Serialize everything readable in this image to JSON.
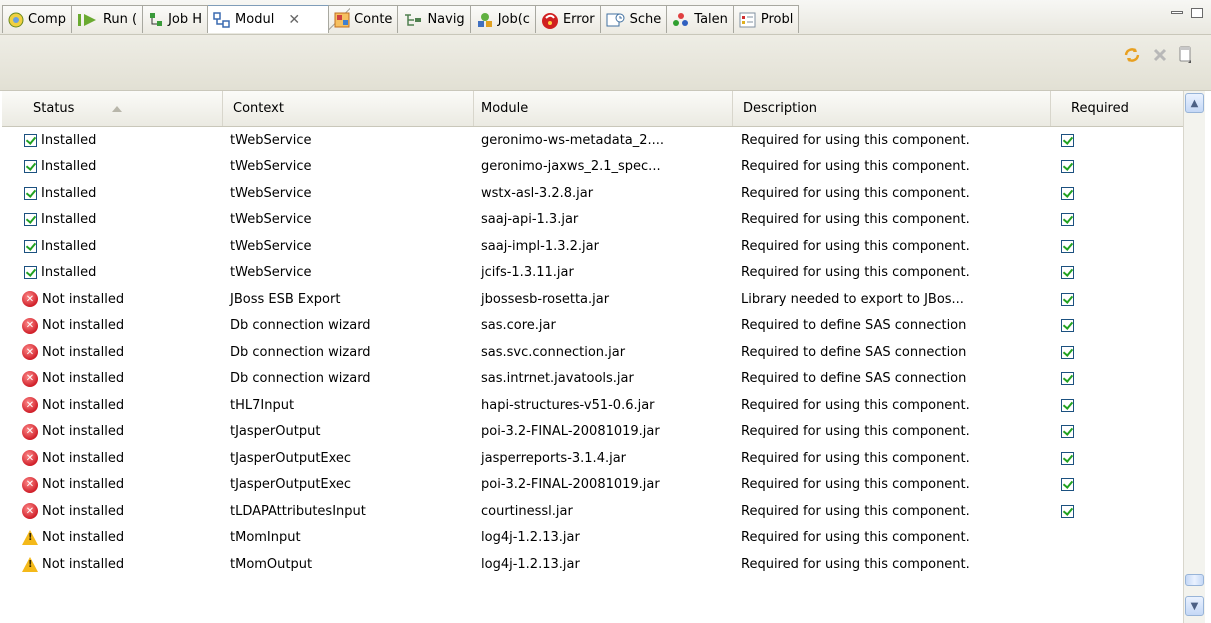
{
  "tabs": [
    {
      "label": "Comp",
      "icon": "component-icon"
    },
    {
      "label": "Run (",
      "icon": "run-icon"
    },
    {
      "label": "Job H",
      "icon": "job-hierarchy-icon"
    },
    {
      "label": "Modul",
      "icon": "modules-icon",
      "active": true
    },
    {
      "label": "Conte",
      "icon": "contexts-icon"
    },
    {
      "label": "Navig",
      "icon": "navigator-icon"
    },
    {
      "label": "Job(c",
      "icon": "job-icon"
    },
    {
      "label": "Error",
      "icon": "error-log-icon"
    },
    {
      "label": "Sche",
      "icon": "scheduler-icon"
    },
    {
      "label": "Talen",
      "icon": "talend-icon"
    },
    {
      "label": "Probl",
      "icon": "problems-icon"
    }
  ],
  "columns": [
    "Status",
    "Context",
    "Module",
    "Description",
    "Required"
  ],
  "rows": [
    {
      "status": "Installed",
      "state": "installed",
      "context": "tWebService",
      "module": "geronimo-ws-metadata_2....",
      "description": "Required for using this component.",
      "required": true
    },
    {
      "status": "Installed",
      "state": "installed",
      "context": "tWebService",
      "module": "geronimo-jaxws_2.1_spec...",
      "description": "Required for using this component.",
      "required": true
    },
    {
      "status": "Installed",
      "state": "installed",
      "context": "tWebService",
      "module": "wstx-asl-3.2.8.jar",
      "description": "Required for using this component.",
      "required": true
    },
    {
      "status": "Installed",
      "state": "installed",
      "context": "tWebService",
      "module": "saaj-api-1.3.jar",
      "description": "Required for using this component.",
      "required": true
    },
    {
      "status": "Installed",
      "state": "installed",
      "context": "tWebService",
      "module": "saaj-impl-1.3.2.jar",
      "description": "Required for using this component.",
      "required": true
    },
    {
      "status": "Installed",
      "state": "installed",
      "context": "tWebService",
      "module": "jcifs-1.3.11.jar",
      "description": "Required for using this component.",
      "required": true
    },
    {
      "status": "Not installed",
      "state": "error",
      "context": "JBoss ESB Export",
      "module": "jbossesb-rosetta.jar",
      "description": "Library needed to export to JBos...",
      "required": true
    },
    {
      "status": "Not installed",
      "state": "error",
      "context": "Db connection wizard",
      "module": "sas.core.jar",
      "description": "Required to define SAS connection",
      "required": true
    },
    {
      "status": "Not installed",
      "state": "error",
      "context": "Db connection wizard",
      "module": "sas.svc.connection.jar",
      "description": "Required to define SAS connection",
      "required": true
    },
    {
      "status": "Not installed",
      "state": "error",
      "context": "Db connection wizard",
      "module": "sas.intrnet.javatools.jar",
      "description": "Required to define SAS connection",
      "required": true
    },
    {
      "status": "Not installed",
      "state": "error",
      "context": "tHL7Input",
      "module": "hapi-structures-v51-0.6.jar",
      "description": "Required for using this component.",
      "required": true
    },
    {
      "status": "Not installed",
      "state": "error",
      "context": "tJasperOutput",
      "module": "poi-3.2-FINAL-20081019.jar",
      "description": "Required for using this component.",
      "required": true
    },
    {
      "status": "Not installed",
      "state": "error",
      "context": "tJasperOutputExec",
      "module": "jasperreports-3.1.4.jar",
      "description": "Required for using this component.",
      "required": true
    },
    {
      "status": "Not installed",
      "state": "error",
      "context": "tJasperOutputExec",
      "module": "poi-3.2-FINAL-20081019.jar",
      "description": "Required for using this component.",
      "required": true
    },
    {
      "status": "Not installed",
      "state": "error",
      "context": "tLDAPAttributesInput",
      "module": "courtinessl.jar",
      "description": "Required for using this component.",
      "required": true
    },
    {
      "status": "Not installed",
      "state": "warning",
      "context": "tMomInput",
      "module": "log4j-1.2.13.jar",
      "description": "Required for using this component.",
      "required": false
    },
    {
      "status": "Not installed",
      "state": "warning",
      "context": "tMomOutput",
      "module": "log4j-1.2.13.jar",
      "description": "Required for using this component.",
      "required": false
    }
  ]
}
